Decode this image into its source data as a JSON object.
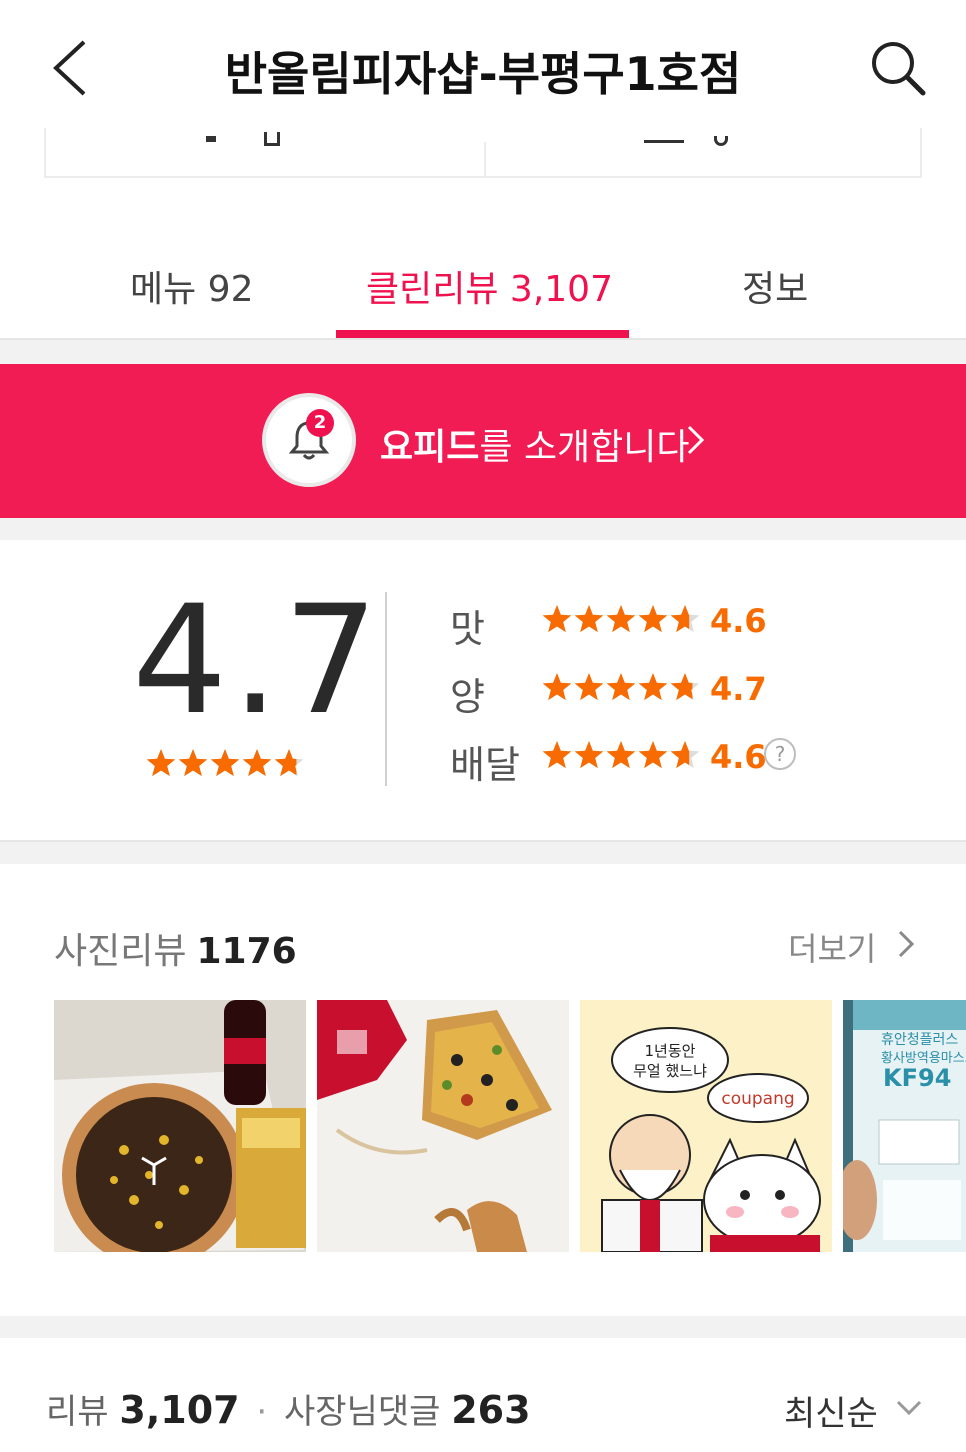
{
  "header": {
    "title": "반올림피자샵-부평구1호점",
    "back_icon": "chevron-left-icon",
    "search_icon": "search-icon"
  },
  "tabs": [
    {
      "label": "메뉴 92",
      "active": false
    },
    {
      "label": "클린리뷰 3,107",
      "active": true
    },
    {
      "label": "정보",
      "active": false
    }
  ],
  "banner": {
    "badge": "2",
    "text_bold": "요피드",
    "text_rest": "를 소개합니다",
    "color": "#f21c54"
  },
  "rating": {
    "overall": "4.7",
    "overall_fraction": 0.94,
    "items": [
      {
        "label": "맛",
        "value": "4.6",
        "fraction": 0.92
      },
      {
        "label": "양",
        "value": "4.7",
        "fraction": 0.94
      },
      {
        "label": "배달",
        "value": "4.6",
        "fraction": 0.92,
        "help": "?"
      }
    ],
    "star_color": "#f76b00"
  },
  "photo_reviews": {
    "title": "사진리뷰",
    "count": "1176",
    "more_label": "더보기",
    "thumb3_bubble1_line1": "1년동안",
    "thumb3_bubble1_line2": "무얼 했느냐",
    "thumb3_bubble2": "coupang",
    "thumb4_brand": "휴안청플러스",
    "thumb4_line": "황사방역용마스크",
    "thumb4_kf": "KF94"
  },
  "review_bar": {
    "review_label": "리뷰",
    "review_count": "3,107",
    "separator": "·",
    "owner_label": "사장님댓글",
    "owner_count": "263",
    "sort_label": "최신순"
  },
  "accent_color": "#f0114f"
}
